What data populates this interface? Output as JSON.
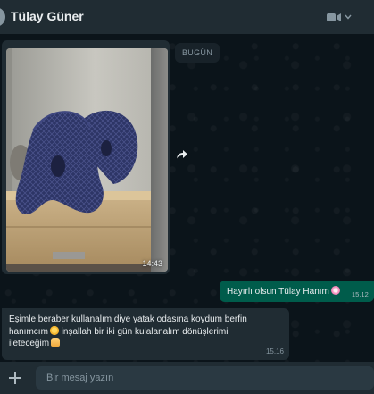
{
  "header": {
    "contact_name": "Tülay Güner",
    "video_icon": "video-camera-icon",
    "dropdown_icon": "chevron-down-icon"
  },
  "chat": {
    "date_divider": "BUGÜN",
    "image_message": {
      "time": "14:43",
      "forward_icon": "forward-icon"
    },
    "outgoing_message": {
      "text": "Hayırlı olsun Tülay Hanım",
      "emoji": "cherry-blossom-emoji",
      "time": "15.12"
    },
    "incoming_message": {
      "line1": "Eşimle beraber kullanalım diye yatak odasına koydum berfin",
      "line2_a": "hanımcım",
      "line2_b": " inşallah bir iki gün kulalanalım dönüşlerimi",
      "line3": "ileteceğim",
      "emoji1": "heart-eyes-emoji",
      "emoji2": "praying-hands-emoji",
      "time": "15.16"
    }
  },
  "footer": {
    "attach_icon": "plus-icon",
    "placeholder": "Bir mesaj yazın",
    "value": ""
  },
  "colors": {
    "header_bg": "#202c33",
    "chat_bg": "#0b141a",
    "outgoing_bubble": "#005c4b",
    "incoming_bubble": "#202c33",
    "input_bg": "#2a3942"
  }
}
